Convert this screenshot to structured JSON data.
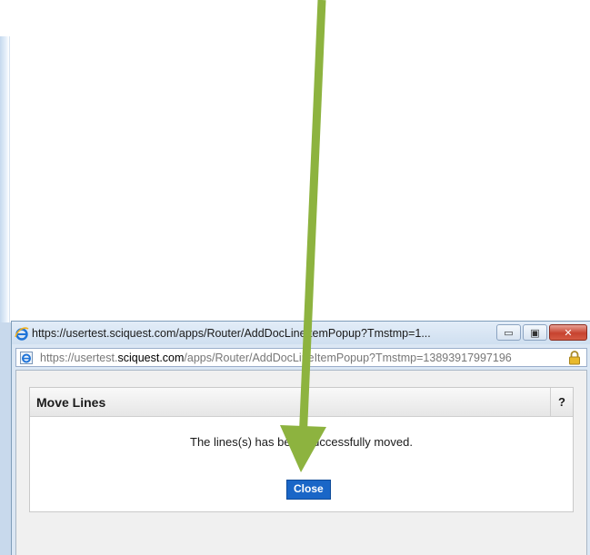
{
  "popup": {
    "title": "https://usertest.sciquest.com/apps/Router/AddDocLineItemPopup?Tmstmp=1...",
    "address": {
      "scheme": "https://usertest.",
      "host": "sciquest.com",
      "path": "/apps/Router/AddDocLineItemPopup?Tmstmp=13893917997196"
    },
    "window_buttons": {
      "minimize": "▭",
      "maximize": "▣",
      "close": "✕"
    }
  },
  "dialog": {
    "title": "Move Lines",
    "help_label": "?",
    "message": "The lines(s) has been successfully moved.",
    "close_label": "Close"
  },
  "icons": {
    "browser": "ie-icon",
    "address": "ie-page-icon",
    "security": "lock-icon"
  },
  "colors": {
    "accent_button": "#1a66c7",
    "annotation_arrow": "#8db33f"
  }
}
